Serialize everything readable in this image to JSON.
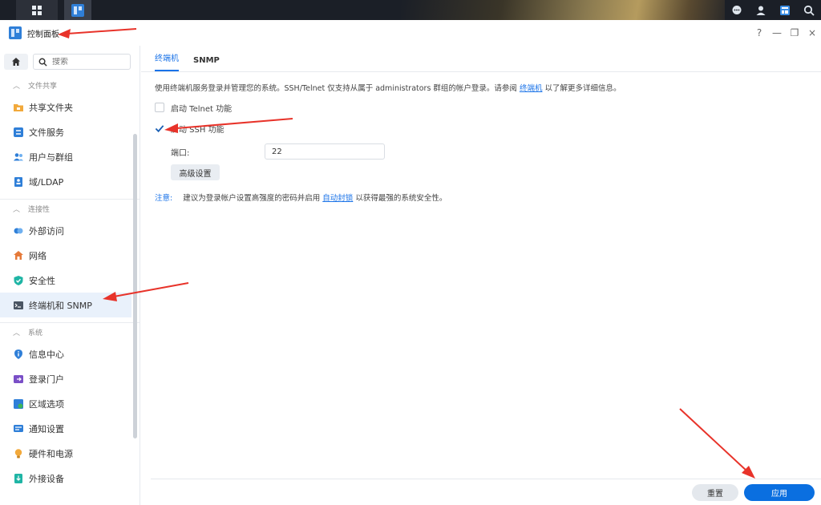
{
  "window": {
    "title": "控制面板",
    "controls": [
      "?",
      "—",
      "❐",
      "×"
    ]
  },
  "sidebar": {
    "search_placeholder": "搜索",
    "groups": [
      {
        "label": "文件共享",
        "items": [
          {
            "label": "共享文件夹",
            "icon": "folder-icon"
          },
          {
            "label": "文件服务",
            "icon": "file-services-icon"
          },
          {
            "label": "用户与群组",
            "icon": "users-icon"
          },
          {
            "label": "域/LDAP",
            "icon": "domain-icon"
          }
        ]
      },
      {
        "label": "连接性",
        "items": [
          {
            "label": "外部访问",
            "icon": "external-access-icon"
          },
          {
            "label": "网络",
            "icon": "network-icon"
          },
          {
            "label": "安全性",
            "icon": "shield-icon"
          },
          {
            "label": "终端机和 SNMP",
            "icon": "terminal-icon"
          }
        ]
      },
      {
        "label": "系统",
        "items": [
          {
            "label": "信息中心",
            "icon": "info-icon"
          },
          {
            "label": "登录门户",
            "icon": "login-portal-icon"
          },
          {
            "label": "区域选项",
            "icon": "region-icon"
          },
          {
            "label": "通知设置",
            "icon": "notification-icon"
          },
          {
            "label": "硬件和电源",
            "icon": "bulb-icon"
          },
          {
            "label": "外接设备",
            "icon": "external-device-icon"
          }
        ]
      }
    ]
  },
  "main": {
    "tabs": [
      {
        "label": "终端机",
        "active": true
      },
      {
        "label": "SNMP",
        "active": false
      }
    ],
    "description_pre": "使用终端机服务登录并管理您的系统。SSH/Telnet 仅支持从属于 administrators 群组的帐户登录。请参阅",
    "description_link": "终端机",
    "description_post": "以了解更多详细信息。",
    "telnet_label": "启动 Telnet 功能",
    "telnet_checked": false,
    "ssh_label": "启动 SSH 功能",
    "ssh_checked": true,
    "port_label": "端口:",
    "port_value": "22",
    "advanced_button": "高级设置",
    "note_label": "注意:",
    "note_pre": "建议为登录帐户设置高强度的密码并启用",
    "note_link": "自动封锁",
    "note_post": "以获得最强的系统安全性。"
  },
  "footer": {
    "reset_label": "重置",
    "apply_label": "应用"
  },
  "colors": {
    "accent": "#1a73e8",
    "apply_button": "#0a6fe0",
    "arrow": "#e8332a"
  }
}
